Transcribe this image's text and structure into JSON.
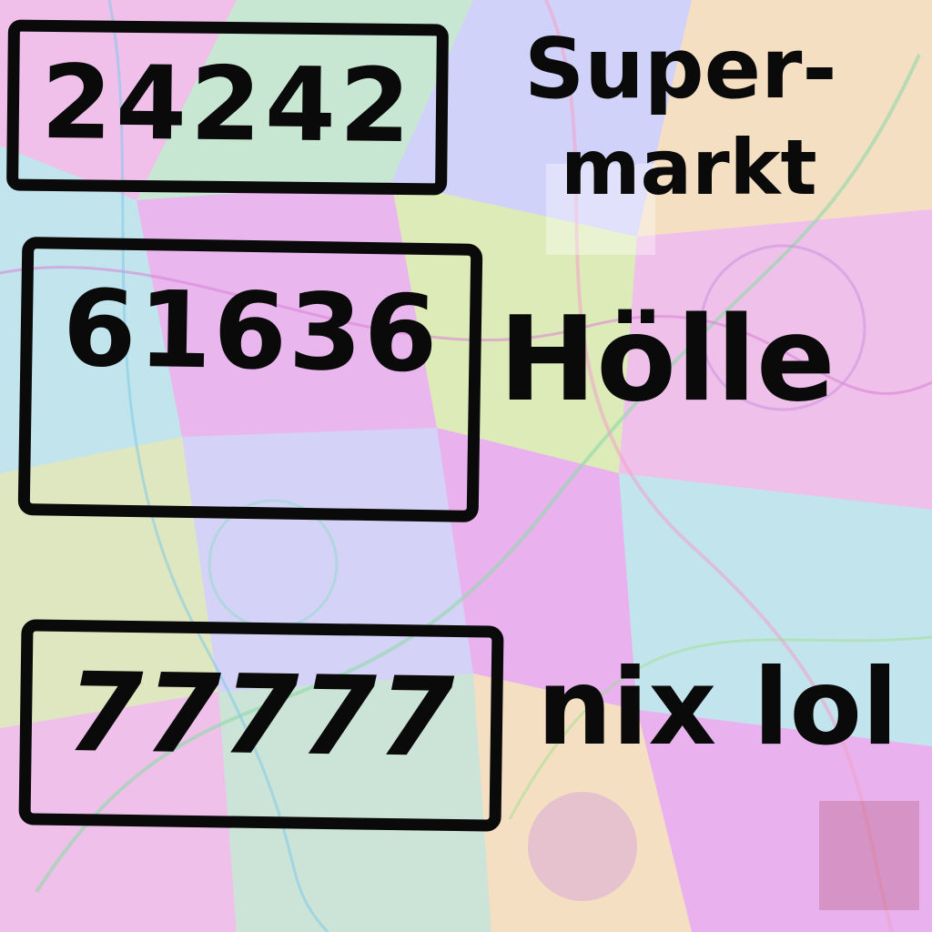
{
  "entries": [
    {
      "code": "24242",
      "label_line1": "Super-",
      "label_line2": "markt"
    },
    {
      "code": "61636",
      "label": "Hölle"
    },
    {
      "code": "77777",
      "label": "nix lol"
    }
  ],
  "colors": {
    "ink": "#0a0a0a",
    "background_palette": [
      "#f3b6e9",
      "#b9f0c9",
      "#c7d2ff",
      "#fde7a8",
      "#a9f2ef",
      "#e9a3f0",
      "#d8f5a4",
      "#ffffff"
    ]
  }
}
